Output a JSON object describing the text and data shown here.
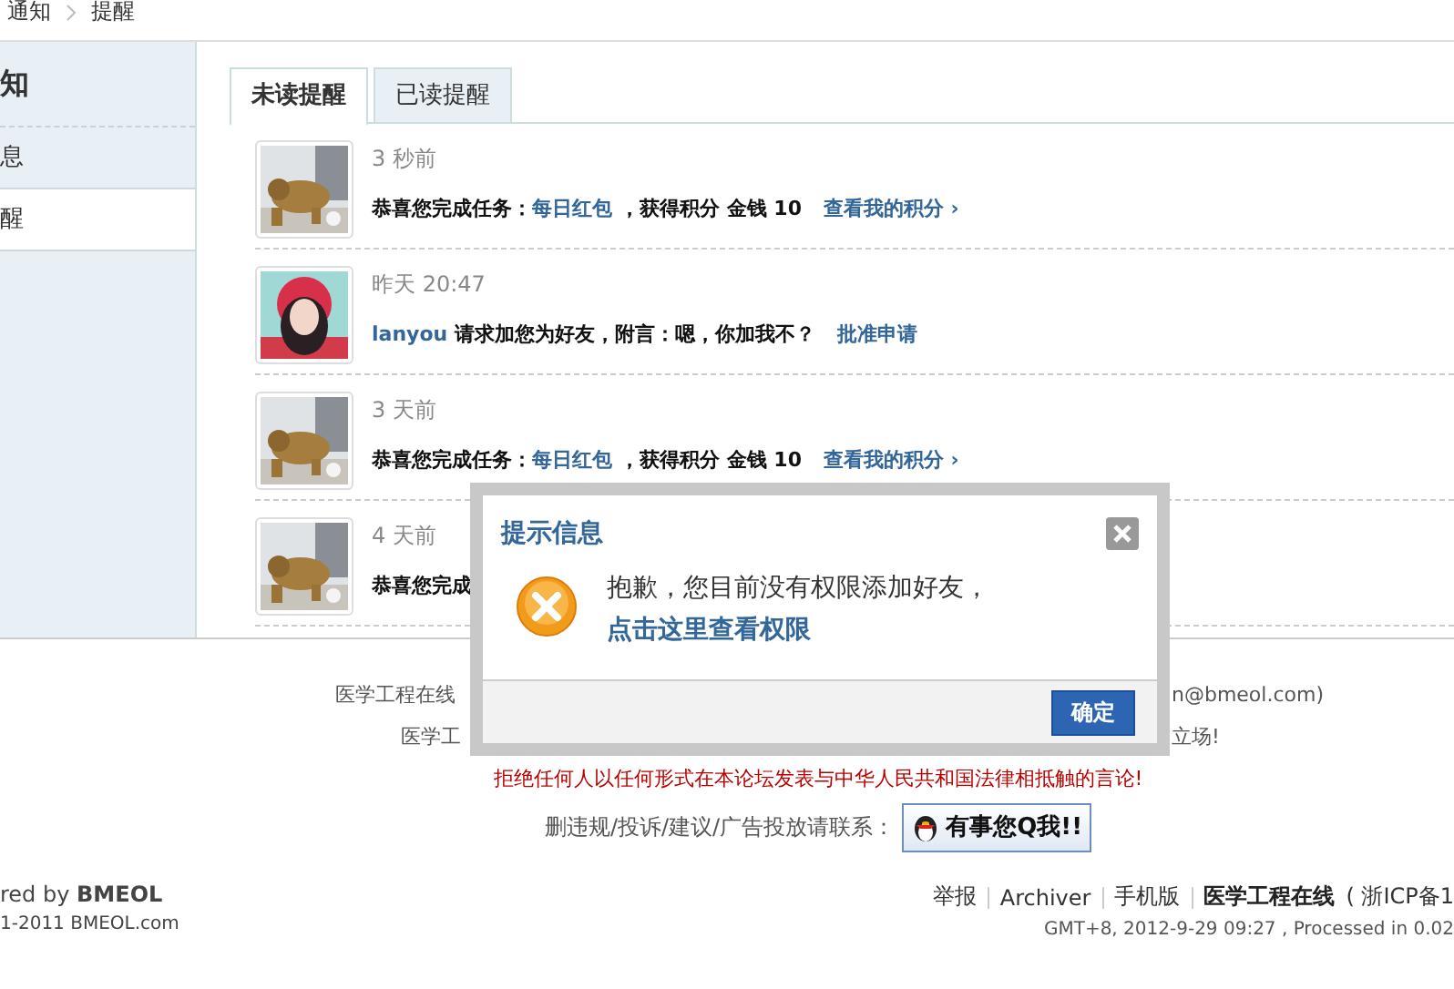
{
  "breadcrumb": [
    {
      "label": "通知"
    },
    {
      "label": "提醒"
    }
  ],
  "sidebar": {
    "title": "知",
    "items": [
      {
        "label": "息",
        "selected": false
      },
      {
        "label": "醒",
        "selected": true
      }
    ]
  },
  "tabs": [
    {
      "label": "未读提醒",
      "selected": true
    },
    {
      "label": "已读提醒",
      "selected": false
    }
  ],
  "notices": [
    {
      "time": "3 秒前",
      "parts": [
        {
          "kind": "text",
          "text": "恭喜您完成任务："
        },
        {
          "kind": "link",
          "text": "每日红包"
        },
        {
          "kind": "text",
          "text": "，获得积分 金钱 10"
        }
      ],
      "action": "查看我的积分 ›"
    },
    {
      "time": "昨天 20:47",
      "parts": [
        {
          "kind": "link",
          "text": "lanyou"
        },
        {
          "kind": "text",
          "text": "请求加您为好友，附言：嗯，你加我不？"
        }
      ],
      "action": "批准申请"
    },
    {
      "time": "3 天前",
      "parts": [
        {
          "kind": "text",
          "text": "恭喜您完成任务："
        },
        {
          "kind": "link",
          "text": "每日红包"
        },
        {
          "kind": "text",
          "text": "，获得积分 金钱 10"
        }
      ],
      "action": "查看我的积分 ›"
    },
    {
      "time": "4 天前",
      "parts": [
        {
          "kind": "text",
          "text": "恭喜您完成"
        }
      ]
    }
  ],
  "footer": {
    "line_1": [
      "医学工程在线",
      "n@bmeol.com)"
    ],
    "line_2": [
      "医学工",
      "立场!"
    ],
    "warning": "拒绝任何人以任何形式在本论坛发表与中华人民共和国法律相抵触的言论!",
    "contact_label": "删违规/投诉/建议/广告投放请联系：",
    "qq_button": "有事您Q我!!"
  },
  "bottom": {
    "powered": "red by **BMEOL**",
    "copyright": "1-2011 BMEOL.com",
    "links": [
      "举报",
      "Archiver",
      "手机版"
    ],
    "site": "医学工程在线",
    "icp": "( 浙ICP备1",
    "time": "GMT+8, 2012-9-29 09:27 , Processed in 0.02"
  },
  "dialog": {
    "title": "提示信息",
    "message": "抱歉，您目前没有权限添加好友，",
    "link": "点击这里查看权限",
    "button": "确定"
  }
}
